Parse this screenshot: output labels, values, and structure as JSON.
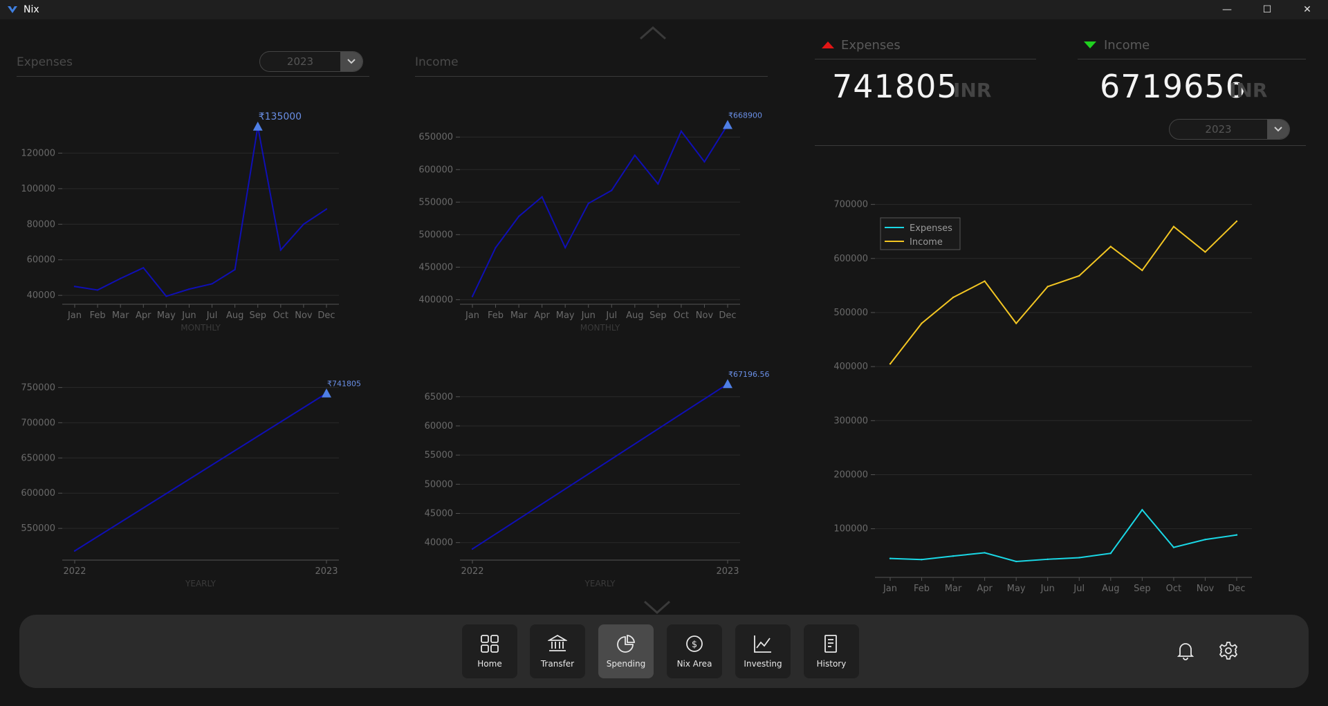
{
  "window": {
    "title": "Nix",
    "minimize": "—",
    "maximize": "☐",
    "close": "✕"
  },
  "expenses_panel": {
    "title": "Expenses",
    "year": "2023"
  },
  "income_panel": {
    "title": "Income"
  },
  "summary": {
    "expenses_label": "Expenses",
    "income_label": "Income",
    "expenses_value": "741805",
    "income_value": "6719656",
    "expenses_unit": "INR",
    "income_unit": "INR",
    "year": "2023",
    "colors": {
      "expenses_arrow": "#e31515",
      "income_arrow": "#1fd11f"
    }
  },
  "nav": {
    "items": [
      {
        "label": "Home",
        "icon": "grid-icon"
      },
      {
        "label": "Transfer",
        "icon": "bank-icon"
      },
      {
        "label": "Spending",
        "icon": "pie-chart-icon",
        "active": true
      },
      {
        "label": "Nix Area",
        "icon": "dollar-exchange-icon"
      },
      {
        "label": "Investing",
        "icon": "line-chart-icon"
      },
      {
        "label": "History",
        "icon": "receipt-icon"
      }
    ],
    "notification_icon": "bell-icon",
    "settings_icon": "gear-icon"
  },
  "chart_data": [
    {
      "id": "expenses-monthly",
      "type": "line",
      "xlabel": "MONTHLY",
      "categories": [
        "Jan",
        "Feb",
        "Mar",
        "Apr",
        "May",
        "Jun",
        "Jul",
        "Aug",
        "Sep",
        "Oct",
        "Nov",
        "Dec"
      ],
      "series": [
        {
          "values": [
            45000,
            43000,
            49500,
            55500,
            39500,
            43500,
            46500,
            54500,
            135000,
            65500,
            80000,
            88500
          ],
          "color": "#0f0fb5"
        }
      ],
      "yticks": [
        40000,
        60000,
        80000,
        100000,
        120000
      ],
      "ylim": [
        35000,
        140000
      ],
      "peak_label": "₹135000",
      "peak_index": 8,
      "grid": true
    },
    {
      "id": "income-monthly",
      "type": "line",
      "xlabel": "MONTHLY",
      "categories": [
        "Jan",
        "Feb",
        "Mar",
        "Apr",
        "May",
        "Jun",
        "Jul",
        "Aug",
        "Sep",
        "Oct",
        "Nov",
        "Dec"
      ],
      "series": [
        {
          "values": [
            405000,
            480000,
            528000,
            558000,
            480000,
            548000,
            568000,
            622000,
            578000,
            659000,
            612000,
            668900
          ],
          "color": "#0f0fb5"
        }
      ],
      "yticks": [
        400000,
        450000,
        500000,
        550000,
        600000,
        650000
      ],
      "ylim": [
        393000,
        680000
      ],
      "peak_label": "₹668900",
      "peak_index": 11,
      "grid": true
    },
    {
      "id": "expenses-yearly",
      "type": "line",
      "xlabel": "YEARLY",
      "categories": [
        "2022",
        "2023"
      ],
      "series": [
        {
          "values": [
            518000,
            741805
          ],
          "color": "#0f0fb5"
        }
      ],
      "yticks": [
        550000,
        600000,
        650000,
        700000,
        750000
      ],
      "ylim": [
        505000,
        770000
      ],
      "peak_label": "₹741805",
      "peak_index": 1,
      "grid": true
    },
    {
      "id": "income-yearly",
      "type": "line",
      "xlabel": "YEARLY",
      "categories": [
        "2022",
        "2023"
      ],
      "series": [
        {
          "values": [
            38900,
            67196.56
          ],
          "color": "#0f0fb5"
        }
      ],
      "yticks": [
        40000,
        45000,
        50000,
        55000,
        60000,
        65000
      ],
      "ylim": [
        37000,
        69000
      ],
      "peak_label": "₹67196.56",
      "peak_index": 1,
      "grid": true
    },
    {
      "id": "combined",
      "type": "line",
      "categories": [
        "Jan",
        "Feb",
        "Mar",
        "Apr",
        "May",
        "Jun",
        "Jul",
        "Aug",
        "Sep",
        "Oct",
        "Nov",
        "Dec"
      ],
      "series": [
        {
          "name": "Expenses",
          "values": [
            45000,
            43000,
            49500,
            55500,
            39500,
            43500,
            46500,
            54500,
            135000,
            65500,
            80000,
            88500
          ],
          "color": "#1ad8e6"
        },
        {
          "name": "Income",
          "values": [
            405000,
            480000,
            528000,
            558000,
            480000,
            548000,
            568000,
            622000,
            578000,
            659000,
            612000,
            668900
          ],
          "color": "#f3c623"
        }
      ],
      "yticks": [
        100000,
        200000,
        300000,
        400000,
        500000,
        600000,
        700000
      ],
      "ylim": [
        10000,
        720000
      ],
      "legend": "top-left",
      "grid": true
    }
  ]
}
